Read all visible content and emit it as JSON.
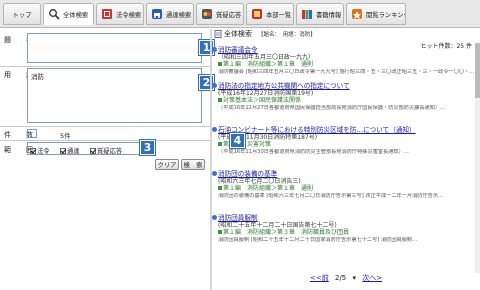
{
  "tabs": [
    {
      "label": "トップ",
      "icon": "none"
    },
    {
      "label": "全体検索",
      "icon": "search-icon"
    },
    {
      "label": "法令検索",
      "icon": "book-icon"
    },
    {
      "label": "通達検索",
      "icon": "car-icon"
    },
    {
      "label": "質疑応答",
      "icon": "qa-icon"
    },
    {
      "label": "本部一覧",
      "icon": "building-icon"
    },
    {
      "label": "書籍情報",
      "icon": "books-icon"
    },
    {
      "label": "閲覧ランキング",
      "icon": "ranking-icon"
    }
  ],
  "search": {
    "title_label": "題　名",
    "title_value": "",
    "term_label": "用　語",
    "term_value": "消防",
    "count_label": "件　数",
    "count_value": "5件",
    "range_label": "範　囲",
    "range_options": [
      "法令",
      "通達",
      "質疑応答"
    ],
    "clear_label": "クリア",
    "search_label": "検　索"
  },
  "badges": [
    "1",
    "2",
    "3",
    "4"
  ],
  "results": {
    "header_title": "全体検索",
    "header_meta": "【題名：　用語：消防】",
    "hits": "ヒット件数：25 件",
    "items": [
      {
        "title": "消防審議会令",
        "sub": "（昭和三四年五月三〇日政一九九）",
        "tags": "第１編　消防組織＞第１章　通則",
        "snip": "消防審議会 [昭和三四年五月三〇日政令第一九九号] 施行昭三四・五・三〇改正昭三五・三・一政令一〇〇・…"
      },
      {
        "title": "消防法の指定地方公共機関への指定について",
        "sub": "(平成16年12月27日消防国第19号)",
        "tags": "対策基本法＞国民保護法関係",
        "snip": "（平成16年12月27日各都道府県国民保護担当部局長宛消防庁国民保護・防災部防災課長通知）…"
      },
      {
        "title": "石油コンビナート等における特別防災区域を防…について（通知）",
        "sub": "(平成16年11月30日消防特第187号)",
        "tags": "第６編　災害対策",
        "snip": "（平成16年11月30日各都道府県消防防災主管部長宛消防庁特殊災害室長通知）…"
      },
      {
        "title": "消防団の装備の基準",
        "sub": "(昭和六三年七月二〇日消告三)",
        "tags": "第１編　消防組織＞第１章　通則",
        "snip": "消防団の装備の基準 [昭和六三年七月二〇日消防庁告示第三号] 改正平成一二年一月消防庁告示…"
      },
      {
        "title": "消防団員服制",
        "sub": "(昭和二十五年十二月二十日国告第七十二号)",
        "tags": "第１編　消防組織＞第３章　消防職員及び団員",
        "snip": "消防団員服制 [昭和二十五年十二月二十日国家消防庁告示第七十二号] 消防団員服制…"
      }
    ],
    "pager_prev": "<<前",
    "pager_page": "2/5",
    "pager_next": "次へ>"
  },
  "colors": {
    "badge": "#3470b5",
    "link": "#1a1aa6",
    "highlight": "#d22222",
    "tag": "#2a7a2a"
  }
}
